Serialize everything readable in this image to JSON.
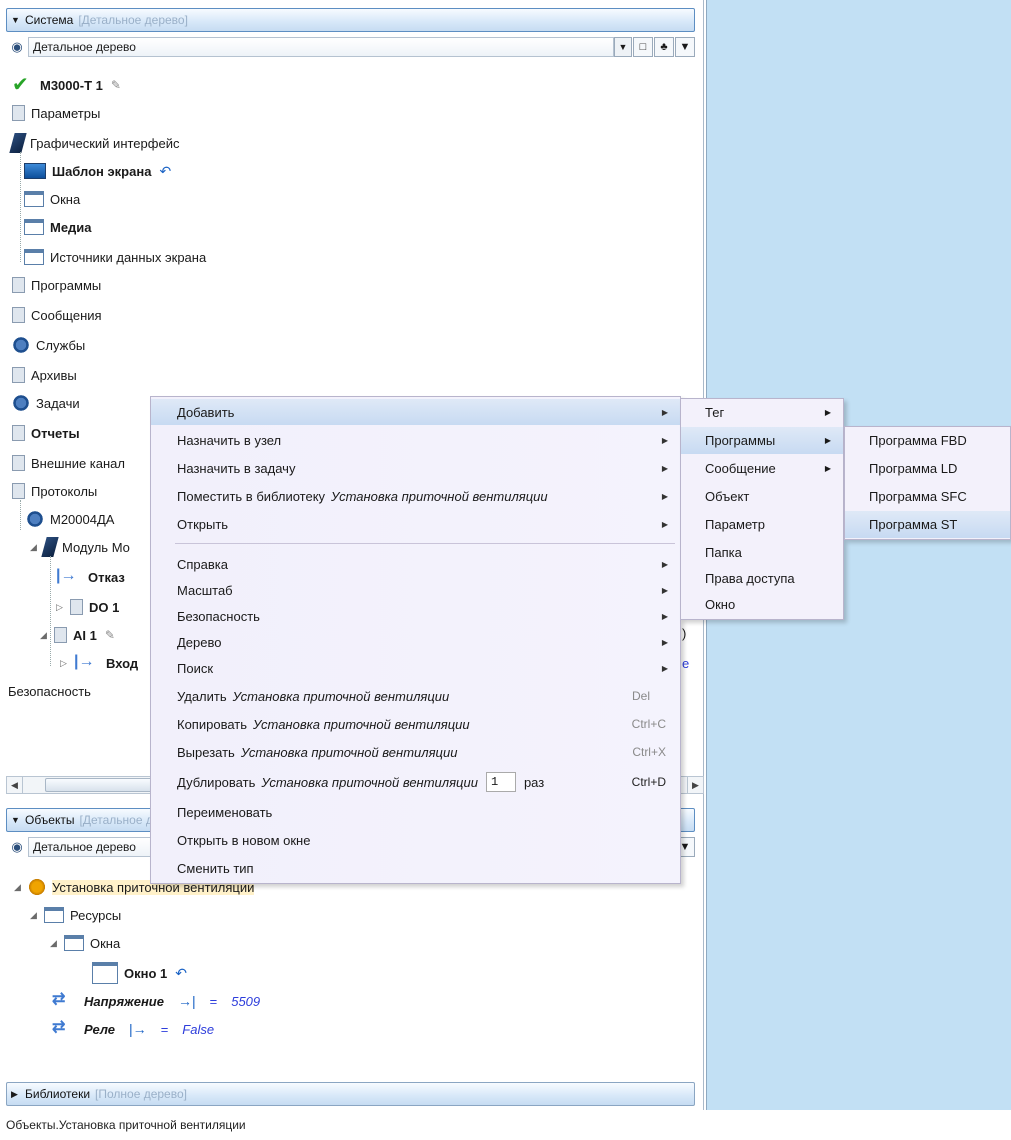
{
  "system_panel": {
    "title": "Система",
    "mode": "[Детальное дерево]",
    "view_select": "Детальное дерево",
    "tree": {
      "root": "M3000-T 1",
      "params": "Параметры",
      "gui": "Графический интерфейс",
      "screen_template": "Шаблон экрана",
      "windows": "Окна",
      "media": "Медиа",
      "screen_data_sources": "Источники данных экрана",
      "programs": "Программы",
      "messages": "Сообщения",
      "services": "Службы",
      "archives": "Архивы",
      "tasks": "Задачи",
      "reports": "Отчеты",
      "ext_channels": "Внешние канал",
      "protocols": "Протоколы",
      "device": "M20004ДА",
      "module": "Модуль Мо",
      "fault": "Отказ",
      "do1": "DO 1",
      "ai1": "AI 1",
      "input": "Вход",
      "security": "Безопасность"
    }
  },
  "objects_panel": {
    "title": "Объекты",
    "mode": "[Детальное дерево]",
    "view_select": "Детальное дерево",
    "tree": {
      "root": "Установка приточной вентиляции",
      "resources": "Ресурсы",
      "windows": "Окна",
      "window1": "Окно 1",
      "voltage": "Напряжение",
      "voltage_eq": "=",
      "voltage_val": "5509",
      "relay": "Реле",
      "relay_eq": "=",
      "relay_val": "False"
    }
  },
  "libraries_panel": {
    "title": "Библиотеки",
    "mode": "[Полное дерево]"
  },
  "status_bar": "Объекты.Установка приточной вентиляции",
  "context_menu": {
    "add": "Добавить",
    "assign_node": "Назначить в узел",
    "assign_task": "Назначить в задачу",
    "put_library": "Поместить в библиотеку",
    "put_library_obj": "Установка приточной вентиляции",
    "open": "Открыть",
    "help": "Справка",
    "scale": "Масштаб",
    "security": "Безопасность",
    "tree": "Дерево",
    "search": "Поиск",
    "delete": "Удалить",
    "delete_obj": "Установка приточной вентиляции",
    "delete_sc": "Del",
    "copy": "Копировать",
    "copy_obj": "Установка приточной вентиляции",
    "copy_sc": "Ctrl+C",
    "cut": "Вырезать",
    "cut_obj": "Установка приточной вентиляции",
    "cut_sc": "Ctrl+X",
    "duplicate": "Дублировать",
    "duplicate_obj": "Установка приточной вентиляции",
    "duplicate_count": "1",
    "duplicate_times": "раз",
    "duplicate_sc": "Ctrl+D",
    "rename": "Переименовать",
    "open_new_window": "Открыть в новом окне",
    "change_type": "Сменить тип"
  },
  "submenu_add": {
    "tag": "Тег",
    "programs": "Программы",
    "message": "Сообщение",
    "object": "Объект",
    "parameter": "Параметр",
    "folder": "Папка",
    "access_rights": "Права доступа",
    "window": "Окно"
  },
  "submenu_programs": {
    "fbd": "Программа FBD",
    "ld": "Программа LD",
    "sfc": "Программа SFC",
    "st": "Программа ST"
  },
  "partial_text": {
    "brace": ")",
    "blue_e": "е"
  },
  "colors": {
    "right_pane": "#c2e0f4",
    "menu_bg": "#f3f1fb",
    "highlight": "#c7daf2",
    "value_blue": "#2d3ddb"
  }
}
